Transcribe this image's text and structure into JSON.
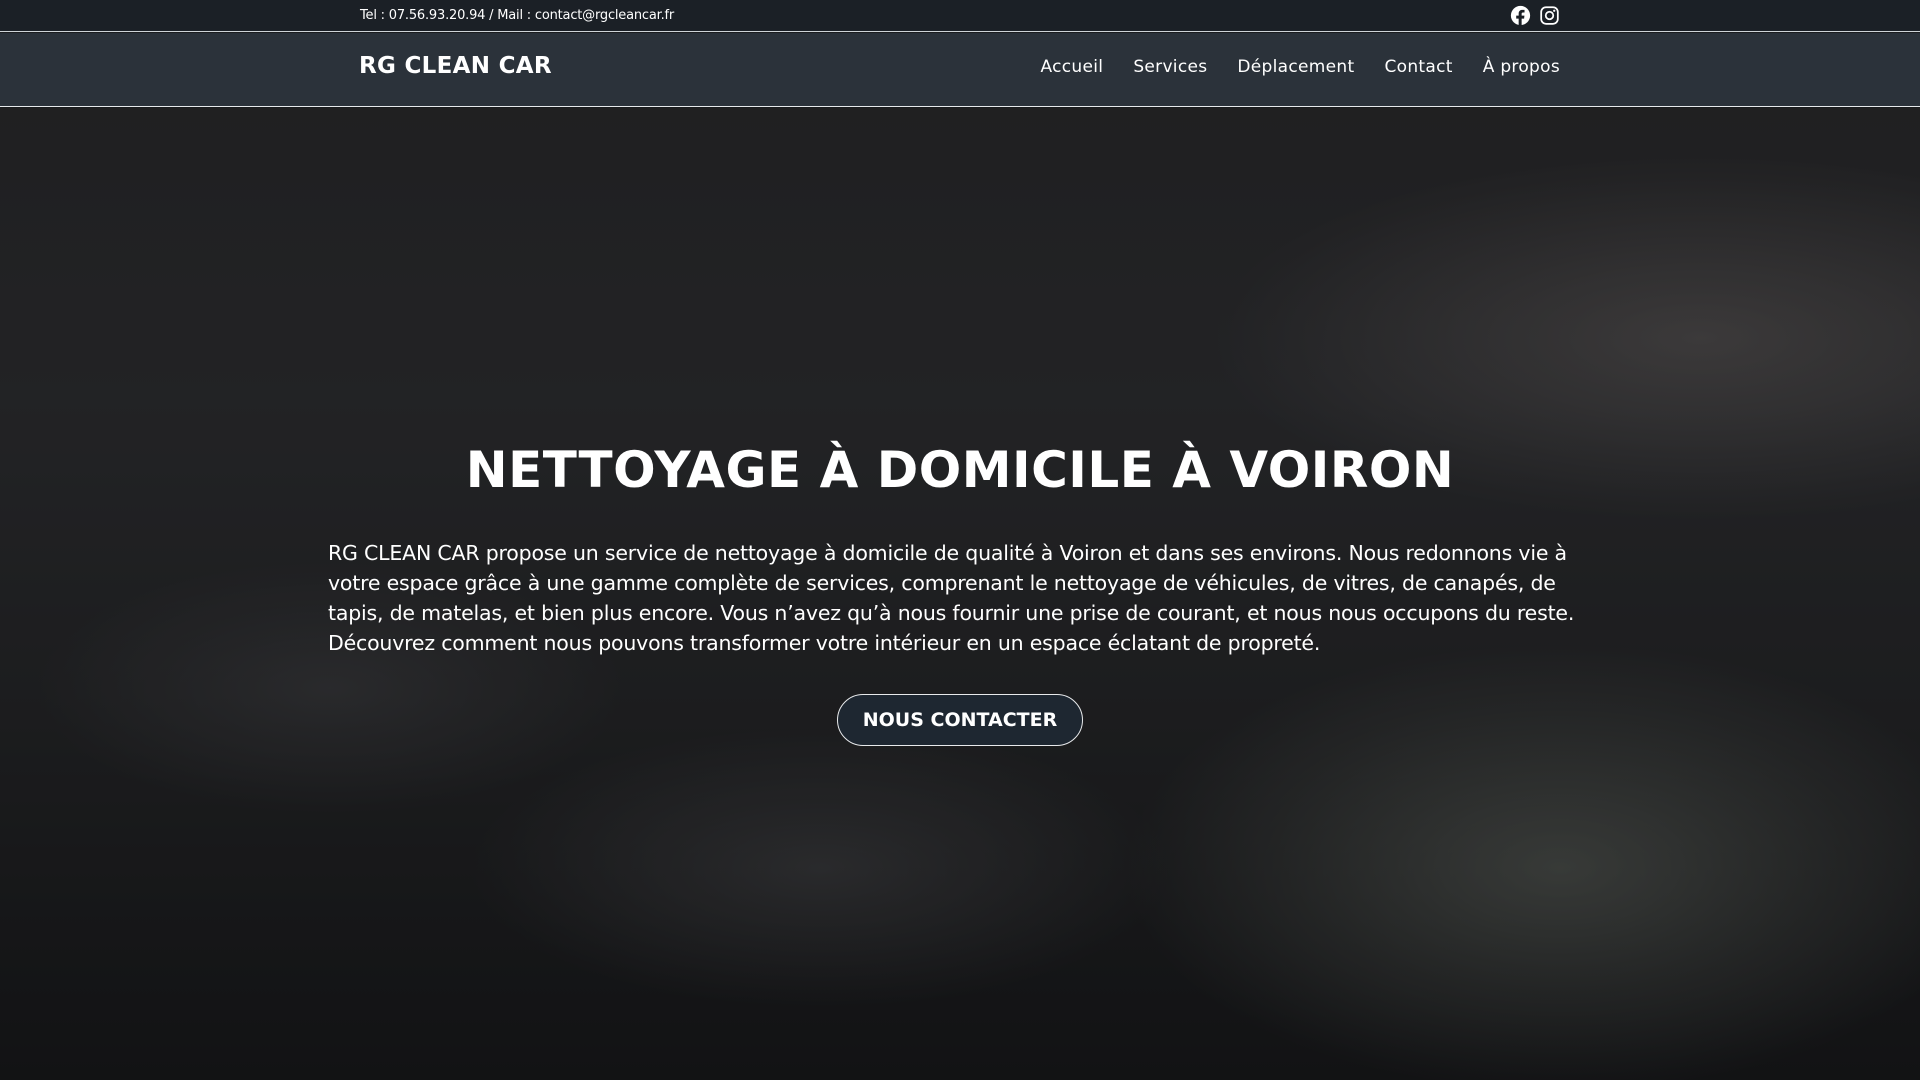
{
  "topbar": {
    "contact_text": "Tel : 07.56.93.20.94 / Mail : contact@rgcleancar.fr",
    "social_icons": [
      "facebook-icon",
      "instagram-icon"
    ]
  },
  "navbar": {
    "logo": "RG CLEAN CAR",
    "links": [
      "Accueil",
      "Services",
      "Déplacement",
      "Contact",
      "À propos"
    ]
  },
  "hero": {
    "title": "NETTOYAGE À DOMICILE À VOIRON",
    "text": "RG CLEAN CAR propose un service de nettoyage à domicile de qualité à Voiron et dans ses environs. Nous redonnons vie à votre espace grâce à une gamme complète de services, comprenant le nettoyage de véhicules, de vitres, de canapés, de tapis, de matelas, et bien plus encore. Vous n’avez qu’à nous fournir une prise de courant, et nous nous occupons du reste. Découvrez comment nous pouvons transformer votre intérieur en un espace éclatant de propreté.",
    "cta_label": "NOUS CONTACTER"
  },
  "colors": {
    "topbar_bg": "#1b2026",
    "navbar_bg": "#2b323a",
    "button_bg": "#1e2731"
  }
}
